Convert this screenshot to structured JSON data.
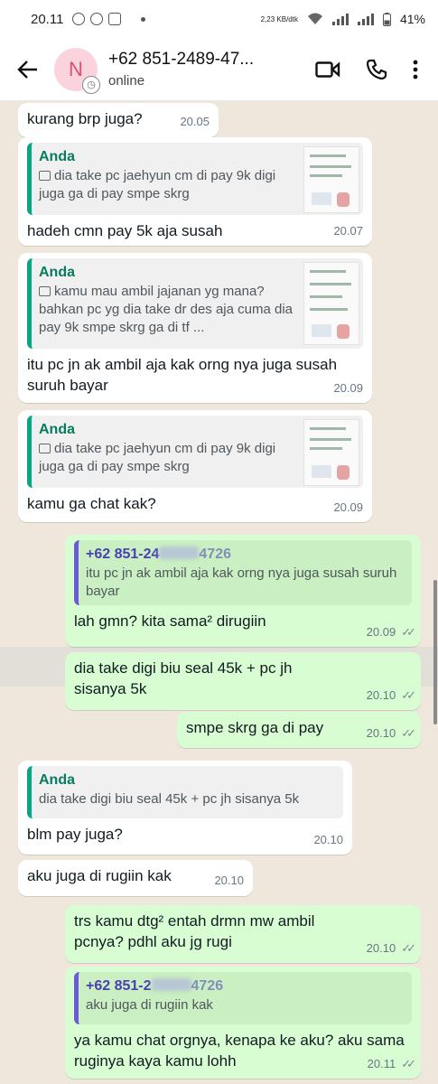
{
  "status_bar": {
    "time": "20.11",
    "speed": "2,23 KB/dtk",
    "battery": "41%"
  },
  "header": {
    "avatar_initial": "N",
    "contact_name": "+62 851-2489-47...",
    "status": "online"
  },
  "messages": [
    {
      "id": "m1",
      "dir": "in",
      "text": "kurang brp juga?",
      "time": "20.05"
    },
    {
      "id": "m2",
      "dir": "in",
      "quote_author": "Anda",
      "quote_text": "dia take pc jaehyun cm di pay 9k digi juga ga di pay smpe skrg",
      "text": "hadeh cmn pay 5k aja susah",
      "time": "20.07"
    },
    {
      "id": "m3",
      "dir": "in",
      "quote_author": "Anda",
      "quote_text": "kamu mau ambil jajanan yg mana? bahkan pc yg dia take dr des aja cuma dia pay 9k smpe skrg ga di tf ...",
      "text": "itu pc jn ak ambil aja kak orng nya juga susah suruh bayar",
      "time": "20.09"
    },
    {
      "id": "m4",
      "dir": "in",
      "quote_author": "Anda",
      "quote_text": "dia take pc jaehyun cm di pay 9k digi juga ga di pay smpe skrg",
      "text": "kamu ga chat kak?",
      "time": "20.09"
    },
    {
      "id": "m5",
      "dir": "out",
      "quote_author": "+62 851-24",
      "quote_author_tail": "4726",
      "quote_text": "itu pc jn ak ambil aja kak orng nya juga susah suruh bayar",
      "text": "lah gmn? kita sama² dirugiin",
      "time": "20.09"
    },
    {
      "id": "m6",
      "dir": "out",
      "text": "dia take digi biu seal 45k + pc jh sisanya 5k",
      "time": "20.10"
    },
    {
      "id": "m7",
      "dir": "out",
      "text": "smpe skrg ga di pay",
      "time": "20.10"
    },
    {
      "id": "m8",
      "dir": "in",
      "quote_author": "Anda",
      "quote_text": "dia take digi biu seal 45k + pc jh sisanya 5k",
      "text": "blm pay juga?",
      "time": "20.10"
    },
    {
      "id": "m9",
      "dir": "in",
      "text": "aku juga di rugiin kak",
      "time": "20.10"
    },
    {
      "id": "m10",
      "dir": "out",
      "text": "trs kamu dtg² entah drmn mw ambil pcnya? pdhl aku jg rugi",
      "time": "20.10"
    },
    {
      "id": "m11",
      "dir": "out",
      "quote_author": "+62 851-2",
      "quote_author_tail": "4726",
      "quote_text": "aku juga di rugiin kak",
      "text": "ya kamu chat orgnya, kenapa ke aku? aku sama ruginya kaya kamu lohh",
      "time": "20.11"
    }
  ]
}
